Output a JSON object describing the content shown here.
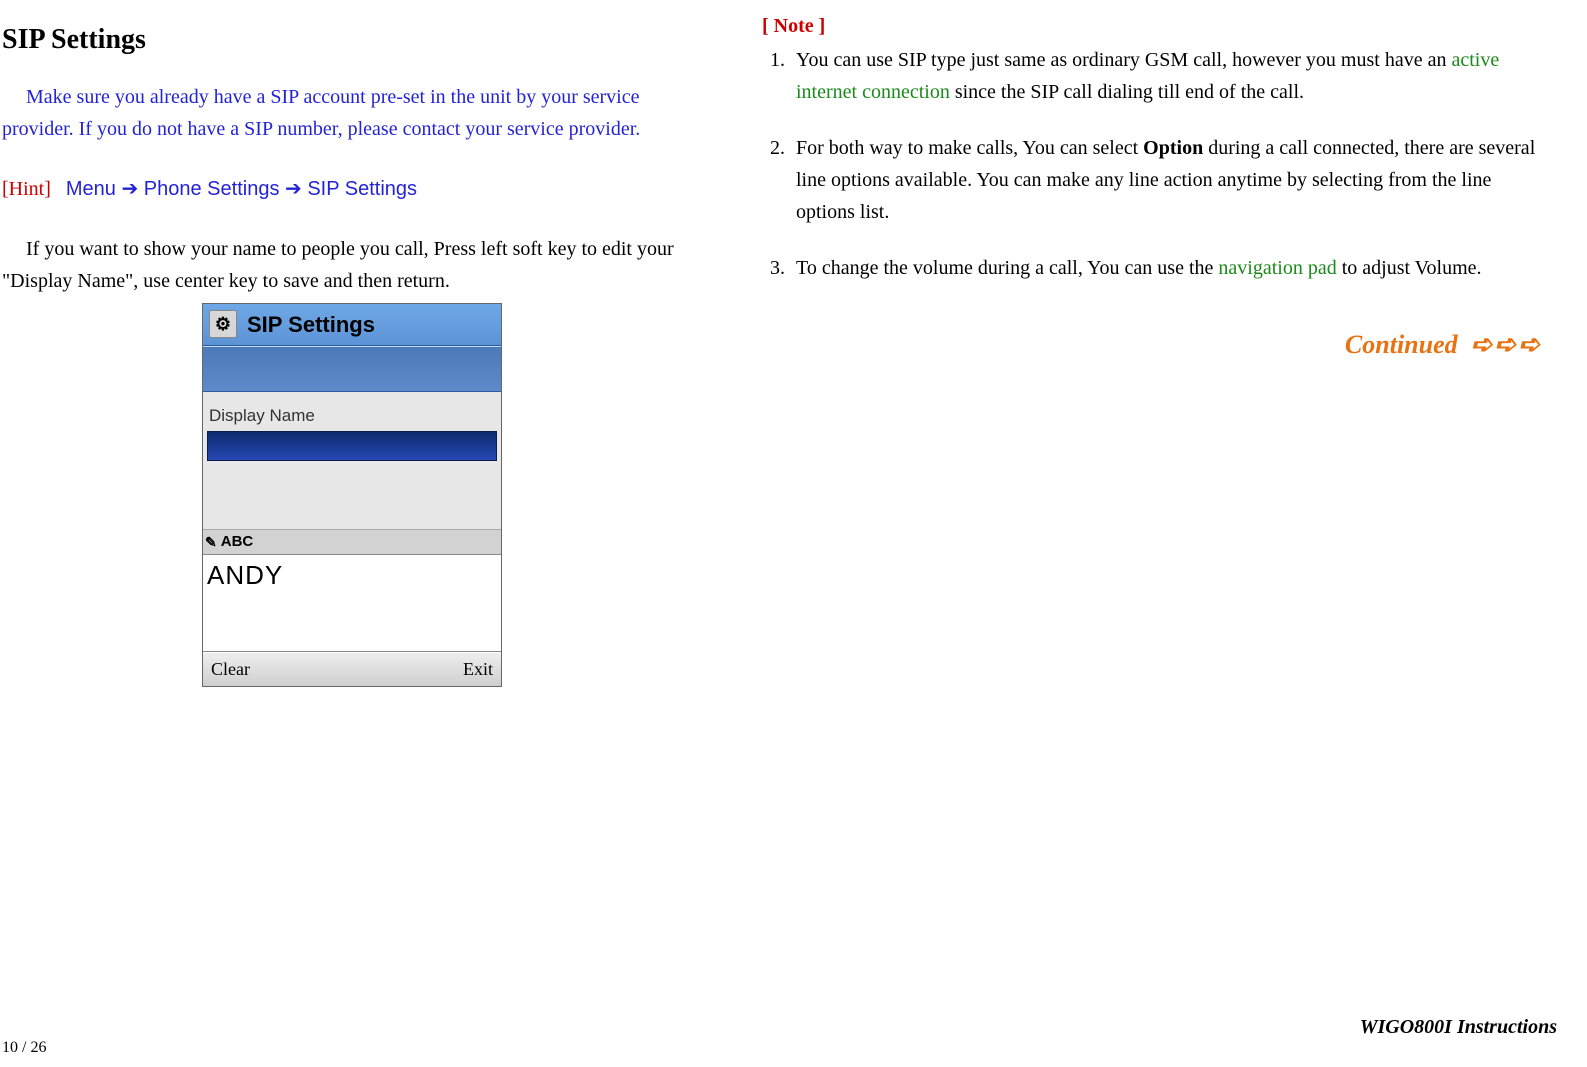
{
  "left": {
    "title": "SIP Settings",
    "intro": "Make sure you already have a SIP account pre-set in the unit by your service provider.    If you do not have a SIP number, please contact your service provider.",
    "hint_label": "[Hint]",
    "hint_path": "Menu ➔ Phone Settings ➔ SIP Settings",
    "para": "If you want to show your name to people you call, Press left soft key to edit your \"Display Name\", use center key to save and then return.",
    "phone": {
      "title": "SIP Settings",
      "field_label": "Display Name",
      "mode": "ABC",
      "value": "ANDY",
      "softkey_left": "Clear",
      "softkey_right": "Exit"
    }
  },
  "right": {
    "note_head": "[ Note ]",
    "notes": {
      "n1_a": "You can use SIP type just same as ordinary GSM call, however you must have an ",
      "n1_green": "active internet connection",
      "n1_b": " since the SIP call dialing till end of the call.",
      "n2_a": "For both way to make calls, You can select ",
      "n2_bold": "Option",
      "n2_b": " during a call connected, there are several line options available. You can make any line action anytime by selecting from the line options list.",
      "n3_a": "To change the volume during a call, You can use the ",
      "n3_green": "navigation pad",
      "n3_b": " to adjust Volume."
    },
    "continued": "Continued",
    "continued_arrows": "➪➪➪"
  },
  "footer": {
    "page": "10 / 26",
    "doc": "WIGO800I Instructions"
  }
}
